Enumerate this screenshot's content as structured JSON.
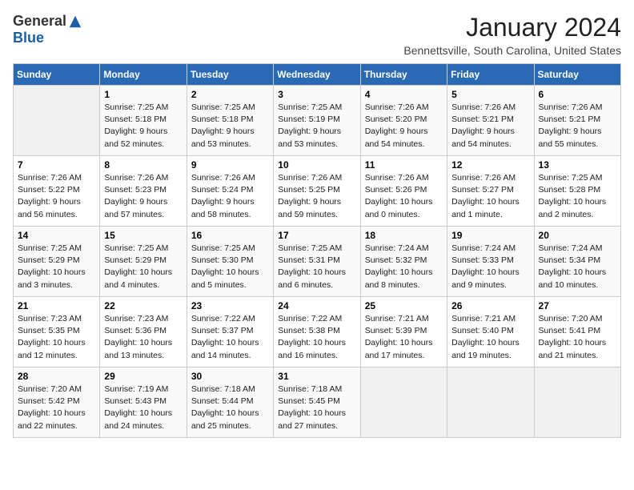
{
  "logo": {
    "general": "General",
    "blue": "Blue"
  },
  "header": {
    "month": "January 2024",
    "location": "Bennettsville, South Carolina, United States"
  },
  "days_of_week": [
    "Sunday",
    "Monday",
    "Tuesday",
    "Wednesday",
    "Thursday",
    "Friday",
    "Saturday"
  ],
  "weeks": [
    [
      {
        "day": "",
        "empty": true
      },
      {
        "day": "1",
        "sunrise": "7:25 AM",
        "sunset": "5:18 PM",
        "daylight": "9 hours and 52 minutes."
      },
      {
        "day": "2",
        "sunrise": "7:25 AM",
        "sunset": "5:18 PM",
        "daylight": "9 hours and 53 minutes."
      },
      {
        "day": "3",
        "sunrise": "7:25 AM",
        "sunset": "5:19 PM",
        "daylight": "9 hours and 53 minutes."
      },
      {
        "day": "4",
        "sunrise": "7:26 AM",
        "sunset": "5:20 PM",
        "daylight": "9 hours and 54 minutes."
      },
      {
        "day": "5",
        "sunrise": "7:26 AM",
        "sunset": "5:21 PM",
        "daylight": "9 hours and 54 minutes."
      },
      {
        "day": "6",
        "sunrise": "7:26 AM",
        "sunset": "5:21 PM",
        "daylight": "9 hours and 55 minutes."
      }
    ],
    [
      {
        "day": "7",
        "sunrise": "7:26 AM",
        "sunset": "5:22 PM",
        "daylight": "9 hours and 56 minutes."
      },
      {
        "day": "8",
        "sunrise": "7:26 AM",
        "sunset": "5:23 PM",
        "daylight": "9 hours and 57 minutes."
      },
      {
        "day": "9",
        "sunrise": "7:26 AM",
        "sunset": "5:24 PM",
        "daylight": "9 hours and 58 minutes."
      },
      {
        "day": "10",
        "sunrise": "7:26 AM",
        "sunset": "5:25 PM",
        "daylight": "9 hours and 59 minutes."
      },
      {
        "day": "11",
        "sunrise": "7:26 AM",
        "sunset": "5:26 PM",
        "daylight": "10 hours and 0 minutes."
      },
      {
        "day": "12",
        "sunrise": "7:26 AM",
        "sunset": "5:27 PM",
        "daylight": "10 hours and 1 minute."
      },
      {
        "day": "13",
        "sunrise": "7:25 AM",
        "sunset": "5:28 PM",
        "daylight": "10 hours and 2 minutes."
      }
    ],
    [
      {
        "day": "14",
        "sunrise": "7:25 AM",
        "sunset": "5:29 PM",
        "daylight": "10 hours and 3 minutes."
      },
      {
        "day": "15",
        "sunrise": "7:25 AM",
        "sunset": "5:29 PM",
        "daylight": "10 hours and 4 minutes."
      },
      {
        "day": "16",
        "sunrise": "7:25 AM",
        "sunset": "5:30 PM",
        "daylight": "10 hours and 5 minutes."
      },
      {
        "day": "17",
        "sunrise": "7:25 AM",
        "sunset": "5:31 PM",
        "daylight": "10 hours and 6 minutes."
      },
      {
        "day": "18",
        "sunrise": "7:24 AM",
        "sunset": "5:32 PM",
        "daylight": "10 hours and 8 minutes."
      },
      {
        "day": "19",
        "sunrise": "7:24 AM",
        "sunset": "5:33 PM",
        "daylight": "10 hours and 9 minutes."
      },
      {
        "day": "20",
        "sunrise": "7:24 AM",
        "sunset": "5:34 PM",
        "daylight": "10 hours and 10 minutes."
      }
    ],
    [
      {
        "day": "21",
        "sunrise": "7:23 AM",
        "sunset": "5:35 PM",
        "daylight": "10 hours and 12 minutes."
      },
      {
        "day": "22",
        "sunrise": "7:23 AM",
        "sunset": "5:36 PM",
        "daylight": "10 hours and 13 minutes."
      },
      {
        "day": "23",
        "sunrise": "7:22 AM",
        "sunset": "5:37 PM",
        "daylight": "10 hours and 14 minutes."
      },
      {
        "day": "24",
        "sunrise": "7:22 AM",
        "sunset": "5:38 PM",
        "daylight": "10 hours and 16 minutes."
      },
      {
        "day": "25",
        "sunrise": "7:21 AM",
        "sunset": "5:39 PM",
        "daylight": "10 hours and 17 minutes."
      },
      {
        "day": "26",
        "sunrise": "7:21 AM",
        "sunset": "5:40 PM",
        "daylight": "10 hours and 19 minutes."
      },
      {
        "day": "27",
        "sunrise": "7:20 AM",
        "sunset": "5:41 PM",
        "daylight": "10 hours and 21 minutes."
      }
    ],
    [
      {
        "day": "28",
        "sunrise": "7:20 AM",
        "sunset": "5:42 PM",
        "daylight": "10 hours and 22 minutes."
      },
      {
        "day": "29",
        "sunrise": "7:19 AM",
        "sunset": "5:43 PM",
        "daylight": "10 hours and 24 minutes."
      },
      {
        "day": "30",
        "sunrise": "7:18 AM",
        "sunset": "5:44 PM",
        "daylight": "10 hours and 25 minutes."
      },
      {
        "day": "31",
        "sunrise": "7:18 AM",
        "sunset": "5:45 PM",
        "daylight": "10 hours and 27 minutes."
      },
      {
        "day": "",
        "empty": true
      },
      {
        "day": "",
        "empty": true
      },
      {
        "day": "",
        "empty": true
      }
    ]
  ],
  "labels": {
    "sunrise": "Sunrise:",
    "sunset": "Sunset:",
    "daylight": "Daylight:"
  }
}
